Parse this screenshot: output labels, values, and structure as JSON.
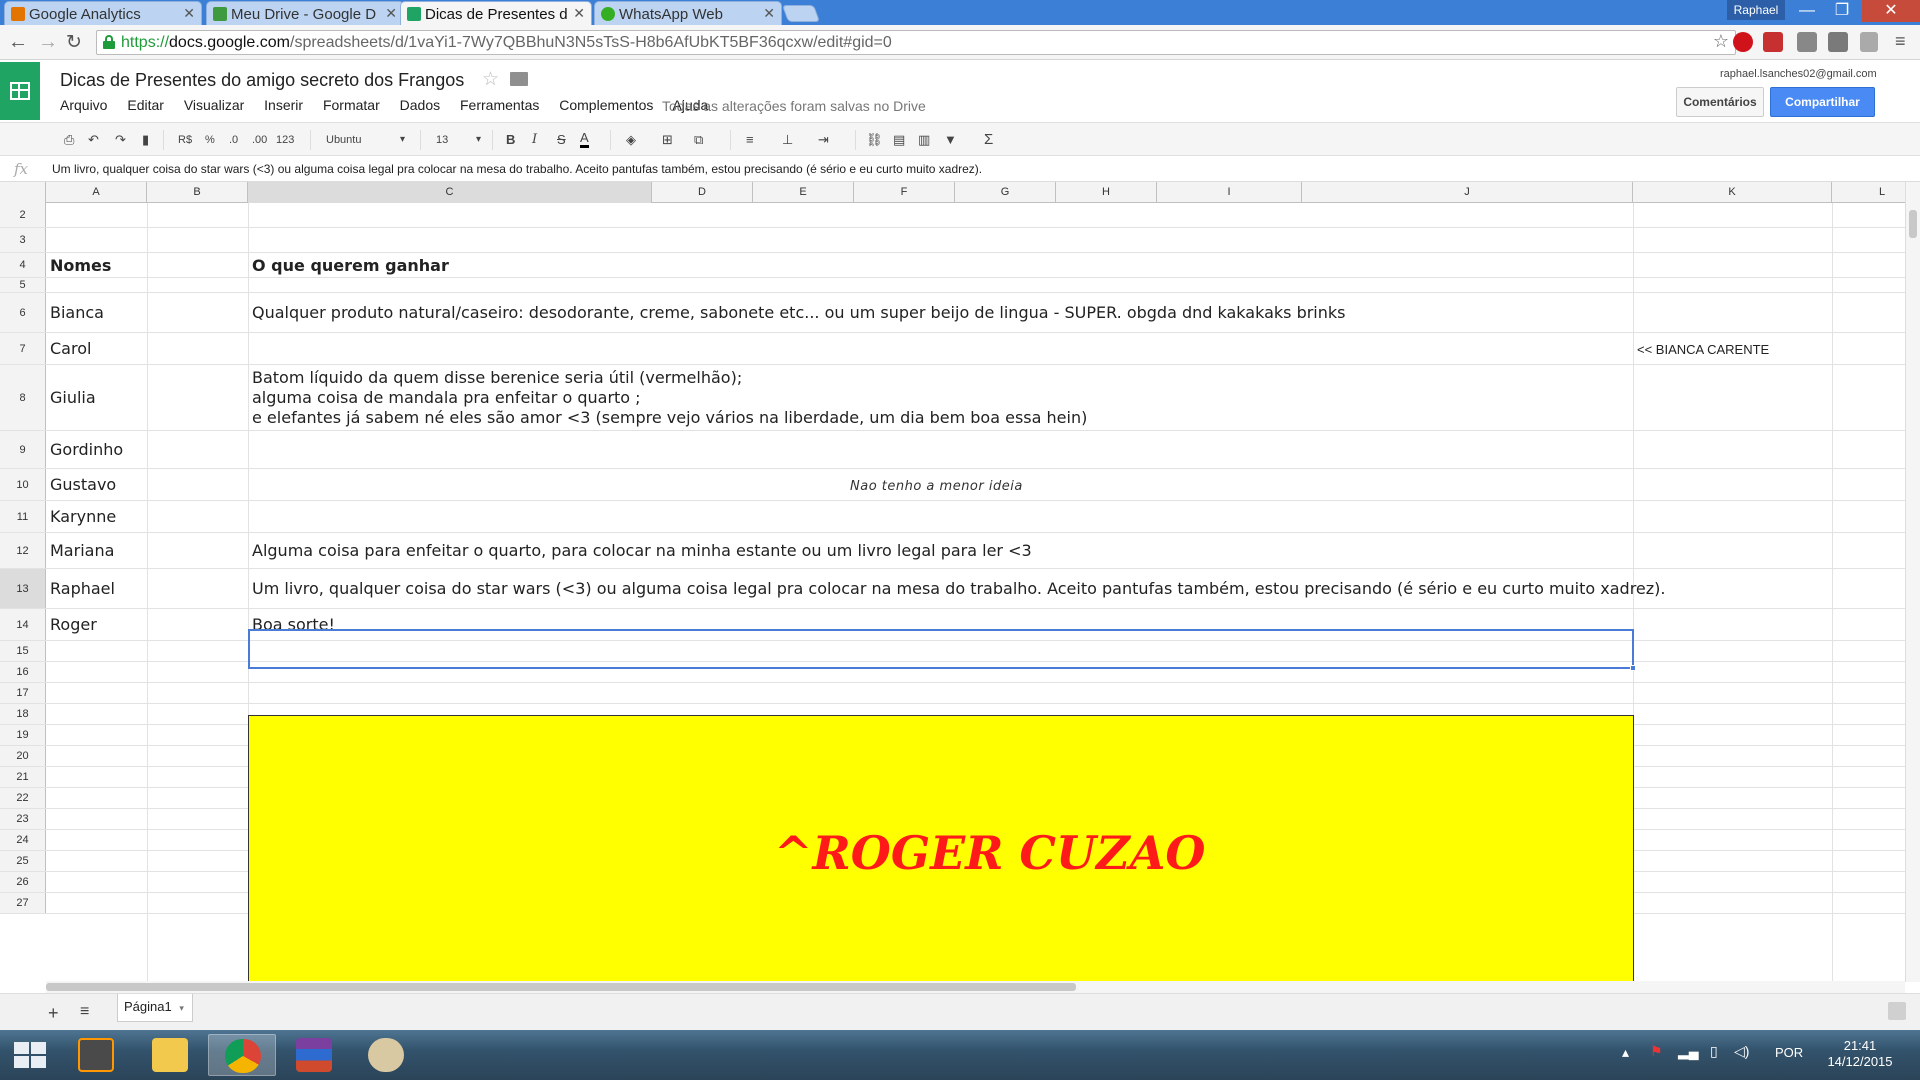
{
  "browser": {
    "tabs": [
      {
        "label": "Google Analytics",
        "color": "#e37400"
      },
      {
        "label": "Meu Drive - Google D",
        "color": "#3d9a3f"
      },
      {
        "label": "Dicas de Presentes d",
        "color": "#20a464"
      },
      {
        "label": "WhatsApp Web",
        "color": "#34af23"
      }
    ],
    "user": "Raphael",
    "url_scheme": "https://",
    "url_host": "docs.google.com",
    "url_path": "/spreadsheets/d/1vaYi1-7Wy7QBBhuN3N5sTsS-H8b6AfUbKT5BF36qcxw/edit#gid=0",
    "window_controls": {
      "minimize": "—",
      "maximize": "❐",
      "close": "✕"
    }
  },
  "sheets": {
    "title": "Dicas de Presentes do amigo secreto dos Frangos",
    "menu": [
      "Arquivo",
      "Editar",
      "Visualizar",
      "Inserir",
      "Formatar",
      "Dados",
      "Ferramentas",
      "Complementos",
      "Ajuda"
    ],
    "save_status": "Todas as alterações foram salvas no Drive",
    "user_email": "raphael.lsanches02@gmail.com",
    "comments_label": "Comentários",
    "share_label": "Compartilhar",
    "toolbar": {
      "currency": "R$",
      "percent": "%",
      "dec_less": ".0",
      "dec_more": ".00",
      "format_more": "123",
      "font": "Ubuntu",
      "font_size": "13",
      "bold": "B",
      "italic": "I",
      "strike": "S",
      "text_color": "A",
      "sum": "Σ"
    },
    "formula": "Um livro, qualquer coisa do star wars (<3) ou alguma coisa legal pra colocar na mesa do trabalho. Aceito pantufas também, estou precisando (é sério e eu curto muito xadrez).",
    "columns": [
      "A",
      "B",
      "C",
      "D",
      "E",
      "F",
      "G",
      "H",
      "I",
      "J",
      "K",
      "L"
    ],
    "rows": [
      {
        "num": "2",
        "name": "",
        "wish": ""
      },
      {
        "num": "3",
        "name": "",
        "wish": ""
      },
      {
        "num": "4",
        "name": "Nomes",
        "wish": "O que querem ganhar"
      },
      {
        "num": "5",
        "name": "",
        "wish": ""
      },
      {
        "num": "6",
        "name": "Bianca",
        "wish": "Qualquer produto natural/caseiro: desodorante, creme, sabonete etc... ou um super beijo de lingua - SUPER. obgda dnd kakakaks brinks"
      },
      {
        "num": "7",
        "name": "Carol",
        "wish": ""
      },
      {
        "num": "8",
        "name": "Giulia",
        "wish": "Batom líquido da quem disse berenice seria útil (vermelhão);"
      },
      {
        "num": "9",
        "name": "Gordinho",
        "wish": ""
      },
      {
        "num": "10",
        "name": "Gustavo",
        "wish": ""
      },
      {
        "num": "11",
        "name": "Karynne",
        "wish": ""
      },
      {
        "num": "12",
        "name": "Mariana",
        "wish": "Alguma coisa para enfeitar o quarto, para colocar na minha estante  ou um livro legal para ler <3"
      },
      {
        "num": "13",
        "name": "Raphael",
        "wish": "Um livro, qualquer coisa do star wars (<3) ou alguma coisa legal pra colocar na mesa do trabalho. Aceito pantufas também, estou precisando (é sério e eu curto muito xadrez)."
      },
      {
        "num": "14",
        "name": "Roger",
        "wish": "Boa sorte!"
      },
      {
        "num": "15",
        "name": "",
        "wish": ""
      },
      {
        "num": "16",
        "name": "",
        "wish": ""
      },
      {
        "num": "17",
        "name": "",
        "wish": ""
      },
      {
        "num": "18",
        "name": "",
        "wish": ""
      },
      {
        "num": "19",
        "name": "",
        "wish": ""
      },
      {
        "num": "20",
        "name": "",
        "wish": ""
      },
      {
        "num": "21",
        "name": "",
        "wish": ""
      },
      {
        "num": "22",
        "name": "",
        "wish": ""
      },
      {
        "num": "23",
        "name": "",
        "wish": ""
      },
      {
        "num": "24",
        "name": "",
        "wish": ""
      },
      {
        "num": "25",
        "name": "",
        "wish": ""
      },
      {
        "num": "26",
        "name": "",
        "wish": ""
      },
      {
        "num": "27",
        "name": "",
        "wish": ""
      }
    ],
    "giulia_line2": "alguma coisa de mandala pra enfeitar o quarto ;",
    "giulia_line3": "e elefantes já sabem né eles são amor <3 (sempre vejo vários na liberdade, um dia bem boa essa hein)",
    "gordinho_note": "Nao tenho a menor ideia",
    "bianca_side_note": "<< BIANCA CARENTE",
    "banner": "^ROGER CUZAO",
    "banner_bg": "#ffff00",
    "banner_color": "#ff1a1a",
    "sheet_tab": "Página1"
  },
  "taskbar": {
    "lang": "POR",
    "time": "21:41",
    "date": "14/12/2015",
    "apps": [
      "sublime-text",
      "file-explorer",
      "chrome",
      "winrar",
      "paint"
    ]
  }
}
